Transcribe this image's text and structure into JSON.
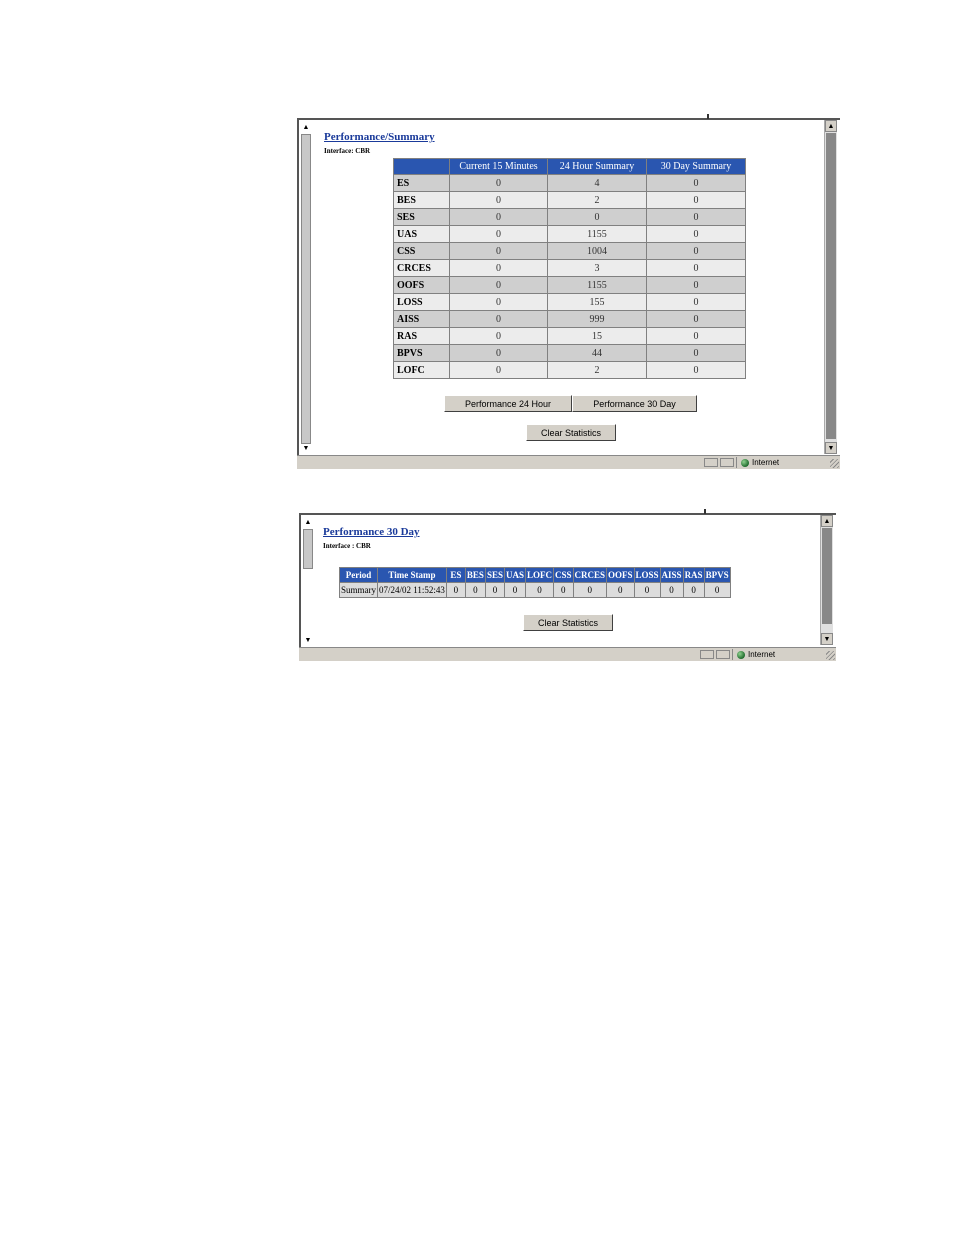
{
  "window1": {
    "title": "Performance/Summary",
    "interface": "Interface: CBR",
    "headers": [
      "",
      "Current 15 Minutes",
      "24 Hour Summary",
      "30 Day Summary"
    ],
    "rows": [
      {
        "label": "ES",
        "c15": "0",
        "h24": "4",
        "d30": "0"
      },
      {
        "label": "BES",
        "c15": "0",
        "h24": "2",
        "d30": "0"
      },
      {
        "label": "SES",
        "c15": "0",
        "h24": "0",
        "d30": "0"
      },
      {
        "label": "UAS",
        "c15": "0",
        "h24": "1155",
        "d30": "0"
      },
      {
        "label": "CSS",
        "c15": "0",
        "h24": "1004",
        "d30": "0"
      },
      {
        "label": "CRCES",
        "c15": "0",
        "h24": "3",
        "d30": "0"
      },
      {
        "label": "OOFS",
        "c15": "0",
        "h24": "1155",
        "d30": "0"
      },
      {
        "label": "LOSS",
        "c15": "0",
        "h24": "155",
        "d30": "0"
      },
      {
        "label": "AISS",
        "c15": "0",
        "h24": "999",
        "d30": "0"
      },
      {
        "label": "RAS",
        "c15": "0",
        "h24": "15",
        "d30": "0"
      },
      {
        "label": "BPVS",
        "c15": "0",
        "h24": "44",
        "d30": "0"
      },
      {
        "label": "LOFC",
        "c15": "0",
        "h24": "2",
        "d30": "0"
      }
    ],
    "btn_24h": "Performance 24 Hour",
    "btn_30d": "Performance 30 Day",
    "btn_clear": "Clear Statistics",
    "status_zone": "Internet"
  },
  "window2": {
    "title": "Performance 30 Day",
    "interface": "Interface : CBR",
    "headers": [
      "Period",
      "Time Stamp",
      "ES",
      "BES",
      "SES",
      "UAS",
      "LOFC",
      "CSS",
      "CRCES",
      "OOFS",
      "LOSS",
      "AISS",
      "RAS",
      "BPVS"
    ],
    "row": [
      "Summary",
      "07/24/02 11:52:43",
      "0",
      "0",
      "0",
      "0",
      "0",
      "0",
      "0",
      "0",
      "0",
      "0",
      "0",
      "0"
    ],
    "btn_clear": "Clear Statistics",
    "status_zone": "Internet"
  }
}
